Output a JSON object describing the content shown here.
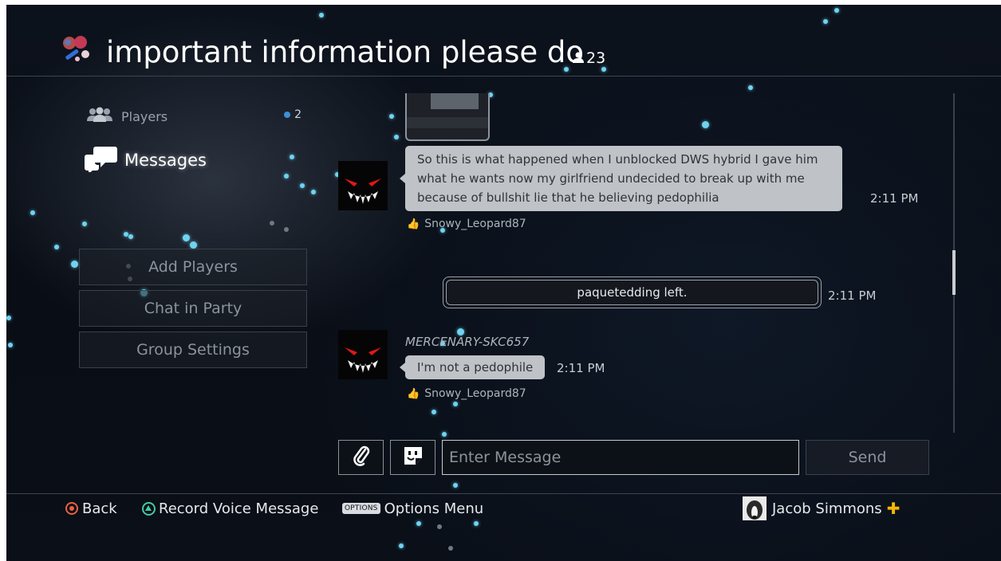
{
  "header": {
    "title": "important information please do",
    "member_count": "23"
  },
  "sidebar": {
    "players_label": "Players",
    "players_count": "2",
    "messages_label": "Messages",
    "buttons": [
      {
        "label": "Add Players"
      },
      {
        "label": "Chat in Party"
      },
      {
        "label": "Group Settings"
      }
    ]
  },
  "messages": [
    {
      "text": "So this is what happened when I unblocked DWS hybrid I gave him what he wants now my girlfriend undecided to break up with me because of bullshit lie that he believing pedophilia",
      "time": "2:11 PM",
      "liked_by": "Snowy_Leopard87"
    },
    {
      "system": "paquetedding left.",
      "time": "2:11 PM"
    },
    {
      "sender": "MERCENARY-SKC657",
      "text": "I'm not a pedophile",
      "time": "2:11 PM",
      "liked_by": "Snowy_Leopard87"
    }
  ],
  "composer": {
    "placeholder": "Enter Message",
    "send_label": "Send"
  },
  "footer": {
    "back_label": "Back",
    "record_label": "Record Voice Message",
    "options_badge": "OPTIONS",
    "options_label": "Options Menu",
    "user_name": "Jacob Simmons"
  },
  "icons": [
    "people-icon",
    "speech-bubbles-icon",
    "person-icon",
    "paperclip-icon",
    "sticker-icon",
    "thumbs-up-icon",
    "plus-icon",
    "circle-button-icon",
    "triangle-button-icon"
  ],
  "colors": {
    "accent_particle": "#6fd3f0",
    "bubble": "#bfc3c7",
    "plus_gold": "#f3b800",
    "circle_button": "#e8623f",
    "triangle_button": "#45c9a2"
  }
}
